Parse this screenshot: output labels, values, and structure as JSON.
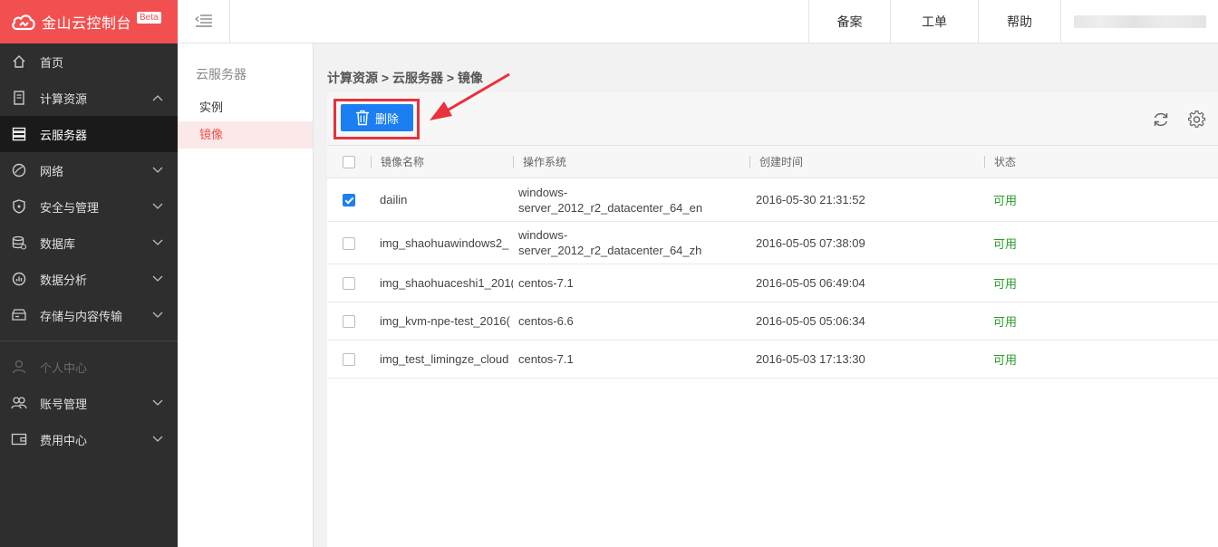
{
  "brand": {
    "title": "金山云控制台",
    "badge": "Beta"
  },
  "nav": {
    "items": [
      {
        "label": "首页",
        "icon": "home-icon"
      },
      {
        "label": "计算资源",
        "icon": "server-doc-icon",
        "chevron": "up"
      },
      {
        "label": "云服务器",
        "icon": "server-stack-icon",
        "active": true
      },
      {
        "label": "网络",
        "icon": "network-icon",
        "chevron": "down"
      },
      {
        "label": "安全与管理",
        "icon": "shield-icon",
        "chevron": "down"
      },
      {
        "label": "数据库",
        "icon": "database-icon",
        "chevron": "down"
      },
      {
        "label": "数据分析",
        "icon": "analytics-icon",
        "chevron": "down"
      },
      {
        "label": "存储与内容传输",
        "icon": "storage-icon",
        "chevron": "down"
      }
    ],
    "personal": [
      {
        "label": "个人中心",
        "icon": "user-icon",
        "disabled": true
      },
      {
        "label": "账号管理",
        "icon": "users-icon",
        "chevron": "down"
      },
      {
        "label": "费用中心",
        "icon": "wallet-icon",
        "chevron": "down"
      }
    ]
  },
  "header": {
    "beian": "备案",
    "gongdan": "工单",
    "help": "帮助"
  },
  "subnav": {
    "title": "云服务器",
    "items": [
      {
        "label": "实例"
      },
      {
        "label": "镜像",
        "active": true
      }
    ]
  },
  "breadcrumb": "计算资源 > 云服务器 > 镜像",
  "toolbar": {
    "delete_label": "删除"
  },
  "table": {
    "columns": {
      "name": "镜像名称",
      "os": "操作系统",
      "created": "创建时间",
      "status": "状态"
    },
    "rows": [
      {
        "checked": true,
        "name": "dailin",
        "os": "windows-server_2012_r2_datacenter_64_en",
        "created": "2016-05-30 21:31:52",
        "status": "可用"
      },
      {
        "checked": false,
        "name": "img_shaohuawindows2_",
        "os": "windows-server_2012_r2_datacenter_64_zh",
        "created": "2016-05-05 07:38:09",
        "status": "可用"
      },
      {
        "checked": false,
        "name": "img_shaohuaceshi1_201(",
        "os": "centos-7.1",
        "created": "2016-05-05 06:49:04",
        "status": "可用"
      },
      {
        "checked": false,
        "name": "img_kvm-npe-test_2016(",
        "os": "centos-6.6",
        "created": "2016-05-05 05:06:34",
        "status": "可用"
      },
      {
        "checked": false,
        "name": "img_test_limingze_cloud",
        "os": "centos-7.1",
        "created": "2016-05-03 17:13:30",
        "status": "可用"
      }
    ]
  },
  "colors": {
    "brand_red": "#f25050",
    "primary_blue": "#1b7ff3",
    "status_green": "#2a9d2a",
    "annotation_red": "#e8323c"
  }
}
